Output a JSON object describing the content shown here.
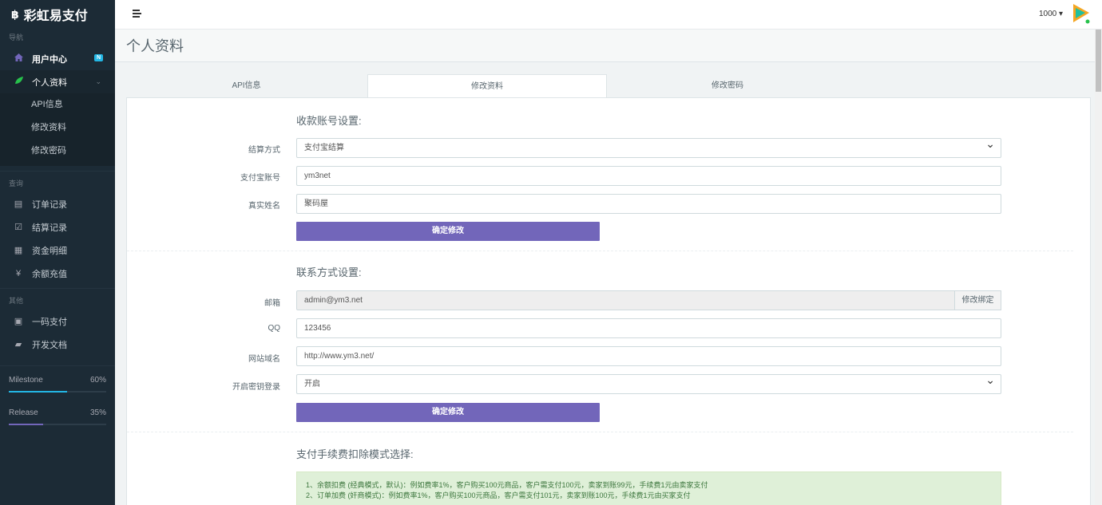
{
  "brand": {
    "icon": "฿",
    "name": "彩虹易支付"
  },
  "sidebar": {
    "headers": {
      "nav": "导航",
      "query": "查询",
      "other": "其他"
    },
    "items": [
      {
        "label": "用户中心",
        "icon": "home-icon",
        "badge": "N"
      },
      {
        "label": "个人资料",
        "icon": "leaf-icon"
      },
      {
        "label": "订单记录",
        "icon": "list-icon"
      },
      {
        "label": "结算记录",
        "icon": "check-icon"
      },
      {
        "label": "资金明细",
        "icon": "table-icon"
      },
      {
        "label": "余额充值",
        "icon": "yen-icon"
      },
      {
        "label": "一码支付",
        "icon": "qrcode-icon"
      },
      {
        "label": "开发文档",
        "icon": "book-icon"
      }
    ],
    "sub_items": [
      "API信息",
      "修改资料",
      "修改密码"
    ],
    "progress": [
      {
        "label": "Milestone",
        "value_label": "60%",
        "value": 0.6,
        "color": "#23b7e5"
      },
      {
        "label": "Release",
        "value_label": "35%",
        "value": 0.35,
        "color": "#7266ba"
      }
    ]
  },
  "header": {
    "user": "1000 ▾"
  },
  "page": {
    "title": "个人资料"
  },
  "tabs": [
    "API信息",
    "修改资料",
    "修改密码"
  ],
  "settlement": {
    "title": "收款账号设置:",
    "method_label": "结算方式",
    "method_value": "支付宝结算",
    "account_label": "支付宝账号",
    "account_value": "ym3net",
    "name_label": "真实姓名",
    "name_value": "聚码屋",
    "submit": "确定修改"
  },
  "contact": {
    "title": "联系方式设置:",
    "email_label": "邮箱",
    "email_value": "admin@ym3.net",
    "email_btn": "修改绑定",
    "qq_label": "QQ",
    "qq_value": "123456",
    "site_label": "网站域名",
    "site_value": "http://www.ym3.net/",
    "key_login_label": "开启密钥登录",
    "key_login_value": "开启",
    "submit": "确定修改"
  },
  "fee": {
    "title": "支付手续费扣除模式选择:",
    "line1": "1、余额扣费 (经典模式，默认)：例如费率1%，客户购买100元商品，客户需支付100元，卖家到账99元，手续费1元由卖家支付",
    "line2": "2、订单加费 (奸商模式)：例如费率1%，客户购买100元商品，客户需支付101元，卖家到账100元，手续费1元由买家支付"
  },
  "colors": {
    "sidebar": "#1c2b36",
    "accent": "#7266ba",
    "info": "#23b7e5",
    "alert_bg": "#dff0d8"
  }
}
